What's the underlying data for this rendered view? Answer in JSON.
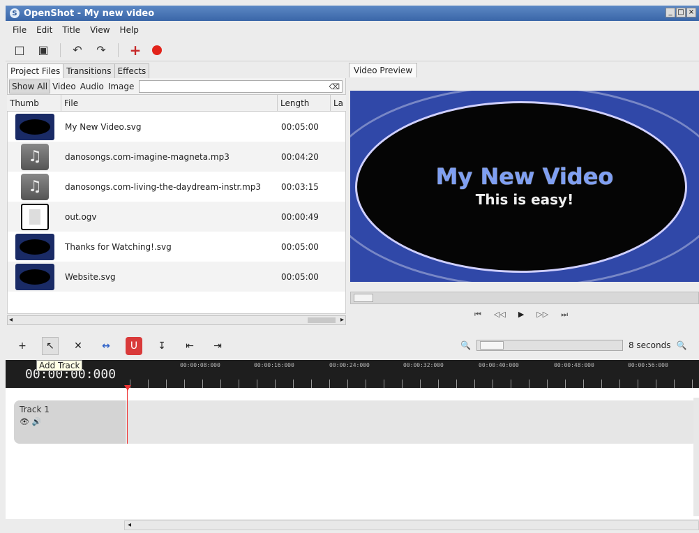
{
  "window": {
    "title": "OpenShot - My new video",
    "controls": [
      "_",
      "□",
      "×"
    ]
  },
  "menu": [
    "File",
    "Edit",
    "Title",
    "View",
    "Help"
  ],
  "toolbar": {
    "new_project_icon": "new-project-icon",
    "import_icon": "import-files-icon",
    "undo_icon": "undo-icon",
    "redo_icon": "redo-icon",
    "add_icon": "add-icon",
    "record_icon": "record-icon",
    "accent_color": "#e2231a"
  },
  "left_tabs": [
    "Project Files",
    "Transitions",
    "Effects"
  ],
  "filters": [
    "Show All",
    "Video",
    "Audio",
    "Image"
  ],
  "search": {
    "placeholder": "",
    "value": ""
  },
  "columns": [
    "Thumb",
    "File",
    "Length",
    "La"
  ],
  "files": [
    {
      "name": "My New Video.svg",
      "length": "00:05:00",
      "thumb": "title"
    },
    {
      "name": "danosongs.com-imagine-magneta.mp3",
      "length": "00:04:20",
      "thumb": "audio"
    },
    {
      "name": "danosongs.com-living-the-daydream-instr.mp3",
      "length": "00:03:15",
      "thumb": "audio"
    },
    {
      "name": "out.ogv",
      "length": "00:00:49",
      "thumb": "video"
    },
    {
      "name": "Thanks for Watching!.svg",
      "length": "00:05:00",
      "thumb": "title"
    },
    {
      "name": "Website.svg",
      "length": "00:05:00",
      "thumb": "title"
    }
  ],
  "preview": {
    "tab": "Video Preview",
    "title": "My New Video",
    "subtitle": "This is easy!",
    "bg_color": "#3048a8"
  },
  "timeline": {
    "tooltip": "Add Track",
    "current_time": "00:00:00:000",
    "ruler_ticks": [
      "00:00:08:000",
      "00:00:16:000",
      "00:00:24:000",
      "00:00:32:000",
      "00:00:40:000",
      "00:00:48:000",
      "00:00:56:000"
    ],
    "zoom_label": "8 seconds",
    "tracks": [
      {
        "name": "Track 1"
      }
    ]
  }
}
